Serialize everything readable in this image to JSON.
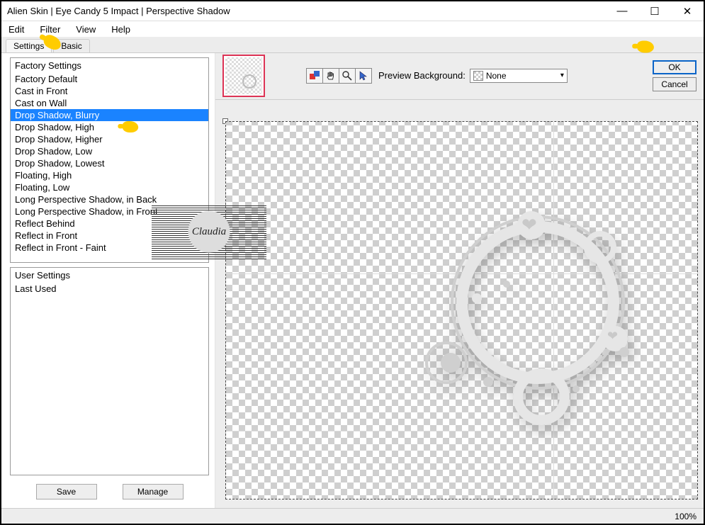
{
  "title": "Alien Skin | Eye Candy 5 Impact | Perspective Shadow",
  "menu": {
    "edit": "Edit",
    "filter": "Filter",
    "view": "View",
    "help": "Help"
  },
  "tabs": {
    "settings": "Settings",
    "basic": "Basic"
  },
  "factory": {
    "header": "Factory Settings",
    "items": [
      "Factory Default",
      "Cast in Front",
      "Cast on Wall",
      "Drop Shadow, Blurry",
      "Drop Shadow, High",
      "Drop Shadow, Higher",
      "Drop Shadow, Low",
      "Drop Shadow, Lowest",
      "Floating, High",
      "Floating, Low",
      "Long Perspective Shadow, in Back",
      "Long Perspective Shadow, in Front",
      "Reflect Behind",
      "Reflect in Front",
      "Reflect in Front - Faint"
    ],
    "selected_index": 3
  },
  "user": {
    "header": "User Settings",
    "items": [
      "Last Used"
    ]
  },
  "buttons": {
    "save": "Save",
    "manage": "Manage",
    "ok": "OK",
    "cancel": "Cancel"
  },
  "preview": {
    "bg_label": "Preview Background:",
    "bg_value": "None"
  },
  "status": {
    "zoom": "100%"
  },
  "watermark": "Claudia"
}
